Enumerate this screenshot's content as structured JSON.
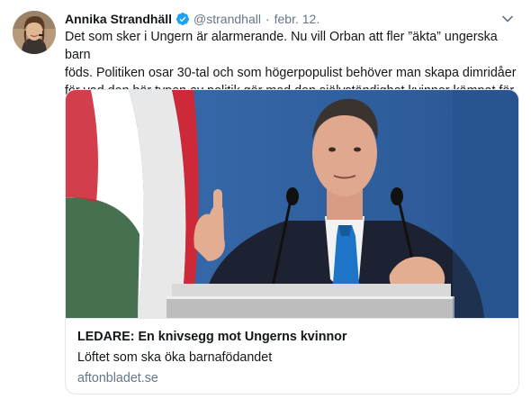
{
  "tweet": {
    "author": {
      "display_name": "Annika Strandhäll",
      "handle": "@strandhall",
      "verified": true,
      "avatar_icon": "profile-photo"
    },
    "separator": "·",
    "date": "febr. 12.",
    "menu_icon": "chevron-down-icon",
    "text_lines": [
      "Det som sker i Ungern är alarmerande. Nu vill Orban att fler ”äkta” ungerska barn",
      "föds. Politiken osar 30-tal och som högerpopulist behöver man skapa dimridåer",
      "för vad den här typen av politik gör med den självständighet kvinnor kämpat för."
    ]
  },
  "card": {
    "image_icon": "article-photo",
    "title": "LEDARE: En knivsegg mot Ungerns kvinnor",
    "description": "Löftet som ska öka barnafödandet",
    "domain": "aftonbladet.se"
  },
  "colors": {
    "text": "#14171a",
    "secondary_text": "#657786",
    "verified_blue": "#1da1f2",
    "border": "#e1e8ed",
    "flag_red": "#ce2939",
    "flag_white": "#ffffff",
    "flag_green": "#477050",
    "tie_blue": "#1e74c6",
    "backdrop_blue": "#2b5c9c"
  }
}
